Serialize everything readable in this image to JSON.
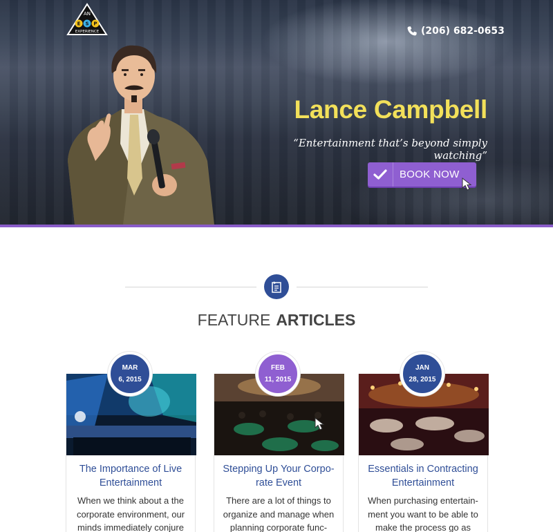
{
  "header": {
    "logo_text": [
      "AN",
      "E",
      "S",
      "P",
      "EXPERIENCE"
    ],
    "phone": "(206) 682-0653"
  },
  "hero": {
    "title": "Lance Campbell",
    "tagline": "“Entertainment that’s beyond simply watching”",
    "cta_label": "BOOK NOW"
  },
  "section": {
    "title_light": "FEATURE",
    "title_bold": "ARTICLES"
  },
  "articles": [
    {
      "month": "MAR",
      "day": "6, 2015",
      "badge_color": "#2f4e97",
      "headline": "The Importance of Live Entertainment",
      "excerpt": "When we think about a the corporate environment, our minds immediately conjure"
    },
    {
      "month": "FEB",
      "day": "11, 2015",
      "badge_color": "#8f5fd1",
      "headline": "Stepping Up Your Corpo-rate Event",
      "excerpt": "There are a lot of things to organize and manage when planning corporate func-"
    },
    {
      "month": "JAN",
      "day": "28, 2015",
      "badge_color": "#2f4e97",
      "headline": "Essentials in Contracting Entertainment",
      "excerpt": "When purchasing entertain-ment you want to be able to make the process go as"
    }
  ],
  "colors": {
    "accent_purple": "#8f5fd1",
    "brand_blue": "#2f4e97",
    "title_yellow": "#f2e05a"
  }
}
